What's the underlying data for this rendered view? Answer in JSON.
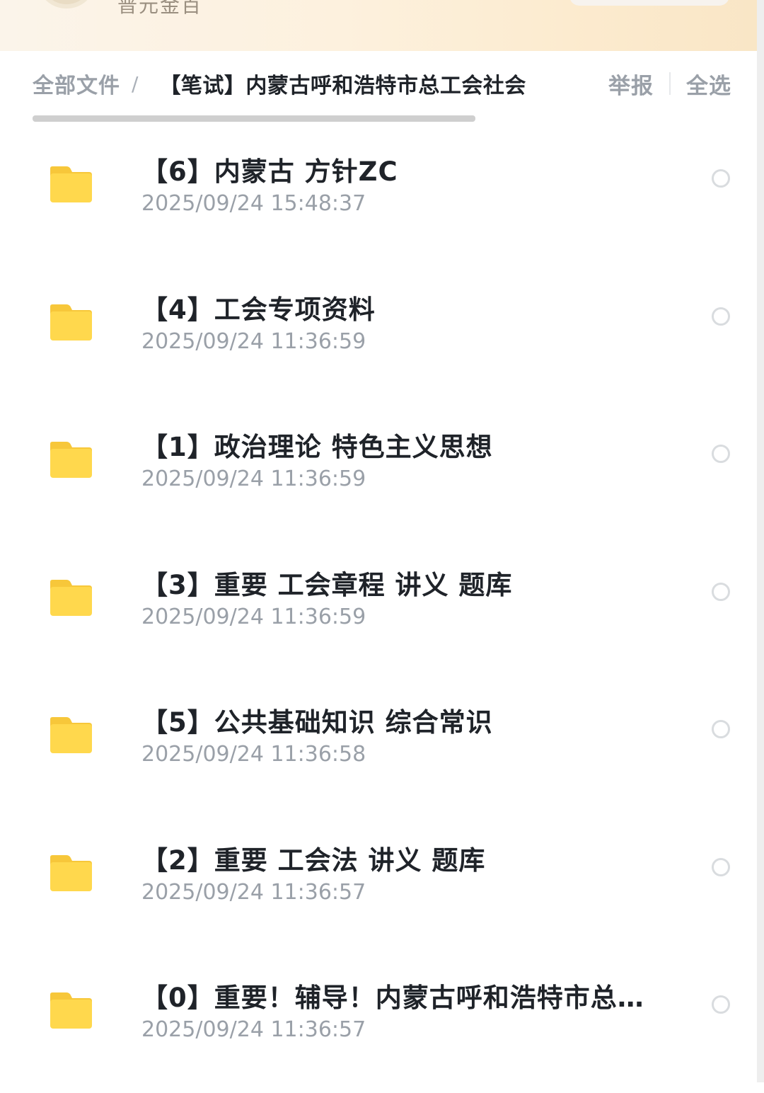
{
  "header": {
    "subtitle": "普元金百"
  },
  "breadcrumb": {
    "root": "全部文件",
    "separator": "/",
    "current": "【笔试】内蒙古呼和浩特市总工会社会"
  },
  "actions": {
    "report": "举报",
    "select_all": "全选"
  },
  "colors": {
    "folder": "#ffd84d",
    "folder_tab": "#f7c73a",
    "title_text": "#1f2329",
    "muted_text": "#9aa0a8"
  },
  "files": [
    {
      "name": "【6】内蒙古 方针ZC",
      "date": "2025/09/24 15:48:37",
      "icon": "folder-icon"
    },
    {
      "name": "【4】工会专项资料",
      "date": "2025/09/24 11:36:59",
      "icon": "folder-icon"
    },
    {
      "name": "【1】政治理论 特色主义思想",
      "date": "2025/09/24 11:36:59",
      "icon": "folder-icon"
    },
    {
      "name": "【3】重要 工会章程 讲义 题库",
      "date": "2025/09/24 11:36:59",
      "icon": "folder-icon"
    },
    {
      "name": "【5】公共基础知识 综合常识",
      "date": "2025/09/24 11:36:58",
      "icon": "folder-icon"
    },
    {
      "name": "【2】重要 工会法 讲义 题库",
      "date": "2025/09/24 11:36:57",
      "icon": "folder-icon"
    },
    {
      "name": "【0】重要！辅导！内蒙古呼和浩特市总…",
      "date": "2025/09/24 11:36:57",
      "icon": "folder-icon"
    }
  ]
}
